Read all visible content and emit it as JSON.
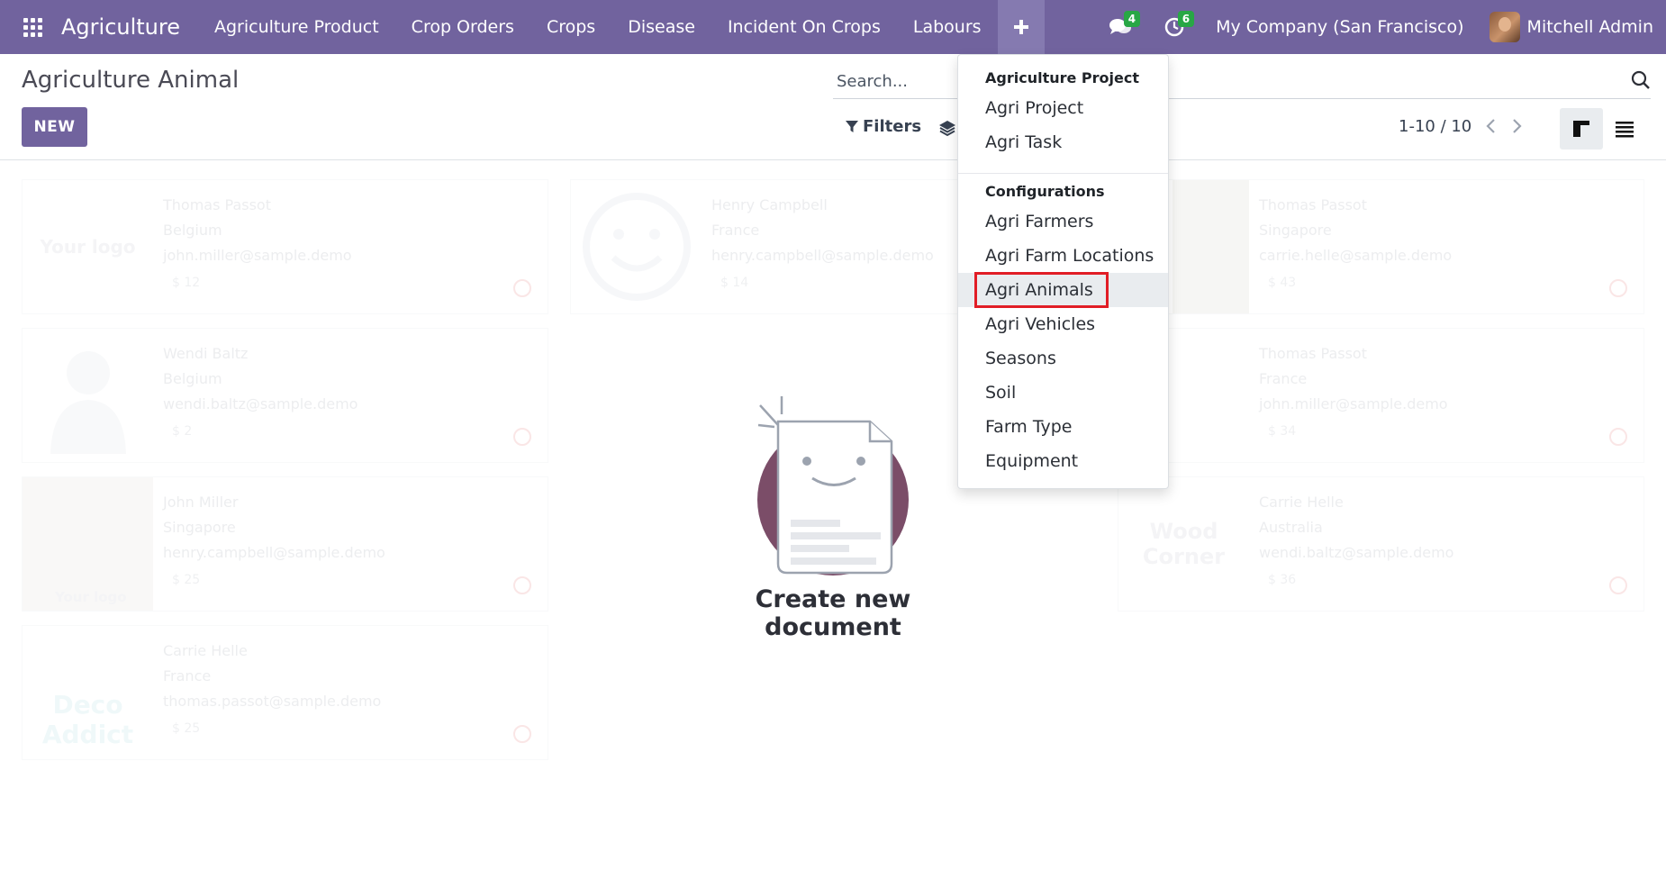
{
  "navbar": {
    "brand": "Agriculture",
    "menu": [
      "Agriculture Product",
      "Crop Orders",
      "Crops",
      "Disease",
      "Incident On Crops",
      "Labours"
    ],
    "messages_count": "4",
    "activities_count": "6",
    "company": "My Company (San Francisco)",
    "user": "Mitchell Admin"
  },
  "control_panel": {
    "title": "Agriculture Animal",
    "new_label": "NEW",
    "search_placeholder": "Search...",
    "filters_label": "Filters",
    "pager": "1-10 / 10"
  },
  "dropdown": {
    "section1_title": "Agriculture Project",
    "section1_items": [
      "Agri Project",
      "Agri Task"
    ],
    "section2_title": "Configurations",
    "section2_items": [
      "Agri Farmers",
      "Agri Farm Locations",
      "Agri Animals",
      "Agri Vehicles",
      "Seasons",
      "Soil",
      "Farm Type",
      "Equipment"
    ]
  },
  "kanban_samples": [
    {
      "name": "Thomas Passot",
      "country": "Belgium",
      "email": "john.miller@sample.demo",
      "price": "$ 12",
      "logo": "Your logo"
    },
    {
      "name": "Henry Campbell",
      "country": "France",
      "email": "henry.campbell@sample.demo",
      "price": "$ 14"
    },
    {
      "name": "Thomas Passot",
      "country": "Singapore",
      "email": "carrie.helle@sample.demo",
      "price": "$ 43"
    },
    {
      "name": "Wendi Baltz",
      "country": "Belgium",
      "email": "wendi.baltz@sample.demo",
      "price": "$ 2"
    },
    {
      "name": "Thomas Passot",
      "country": "France",
      "email": "john.miller@sample.demo",
      "price": "$ 34"
    },
    {
      "name": "John Miller",
      "country": "Singapore",
      "email": "henry.campbell@sample.demo",
      "price": "$ 25",
      "logo": "Your logo"
    },
    {
      "name": "Carrie Helle",
      "country": "Australia",
      "email": "wendi.baltz@sample.demo",
      "price": "$ 36",
      "logo": "Wood Corner"
    },
    {
      "name": "Carrie Helle",
      "country": "France",
      "email": "thomas.passot@sample.demo",
      "price": "$ 25",
      "logo": "Deco Addict"
    }
  ],
  "helper": {
    "title": "Create new document"
  },
  "colors": {
    "navbar": "#71639e",
    "accent": "#71639e",
    "badge": "#28a745",
    "highlight": "#e11d26"
  }
}
